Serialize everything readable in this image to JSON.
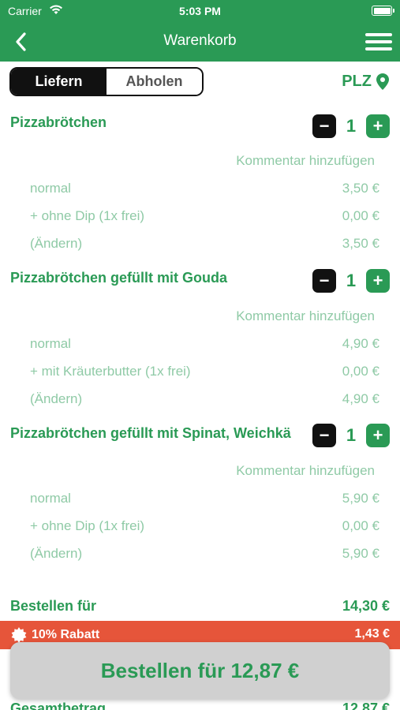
{
  "status": {
    "carrier": "Carrier",
    "time": "5:03 PM"
  },
  "nav": {
    "title": "Warenkorb"
  },
  "mode": {
    "deliver": "Liefern",
    "pickup": "Abholen"
  },
  "plz": {
    "label": "PLZ"
  },
  "items": [
    {
      "title": "Pizzabrötchen",
      "qty": "1",
      "comment": "Kommentar hinzufügen",
      "lines": [
        {
          "label": "normal",
          "price": "3,50 €"
        },
        {
          "label": "+ ohne Dip (1x frei)",
          "price": "0,00 €"
        },
        {
          "label": "(Ändern)",
          "price": "3,50 €"
        }
      ]
    },
    {
      "title": "Pizzabrötchen gefüllt mit Gouda",
      "qty": "1",
      "comment": "Kommentar hinzufügen",
      "lines": [
        {
          "label": "normal",
          "price": "4,90 €"
        },
        {
          "label": "+ mit Kräuterbutter (1x frei)",
          "price": "0,00 €"
        },
        {
          "label": "(Ändern)",
          "price": "4,90 €"
        }
      ]
    },
    {
      "title": "Pizzabrötchen gefüllt mit Spinat, Weichkä",
      "qty": "1",
      "comment": "Kommentar hinzufügen",
      "lines": [
        {
          "label": "normal",
          "price": "5,90 €"
        },
        {
          "label": "+ ohne Dip (1x frei)",
          "price": "0,00 €"
        },
        {
          "label": "(Ändern)",
          "price": "5,90 €"
        }
      ]
    }
  ],
  "summary": {
    "label": "Bestellen für",
    "value": "14,30 €"
  },
  "discount": {
    "label": "10% Rabatt",
    "value": "1,43 €"
  },
  "order_button": {
    "label": "Bestellen für 12,87 €"
  },
  "bottom_peek": {
    "label": "Gesamtbetrag",
    "value": "12,87 €"
  },
  "colors": {
    "brand_green": "#2a9a55",
    "discount_red": "#e6553a",
    "muted_green": "#8fcaa6"
  }
}
